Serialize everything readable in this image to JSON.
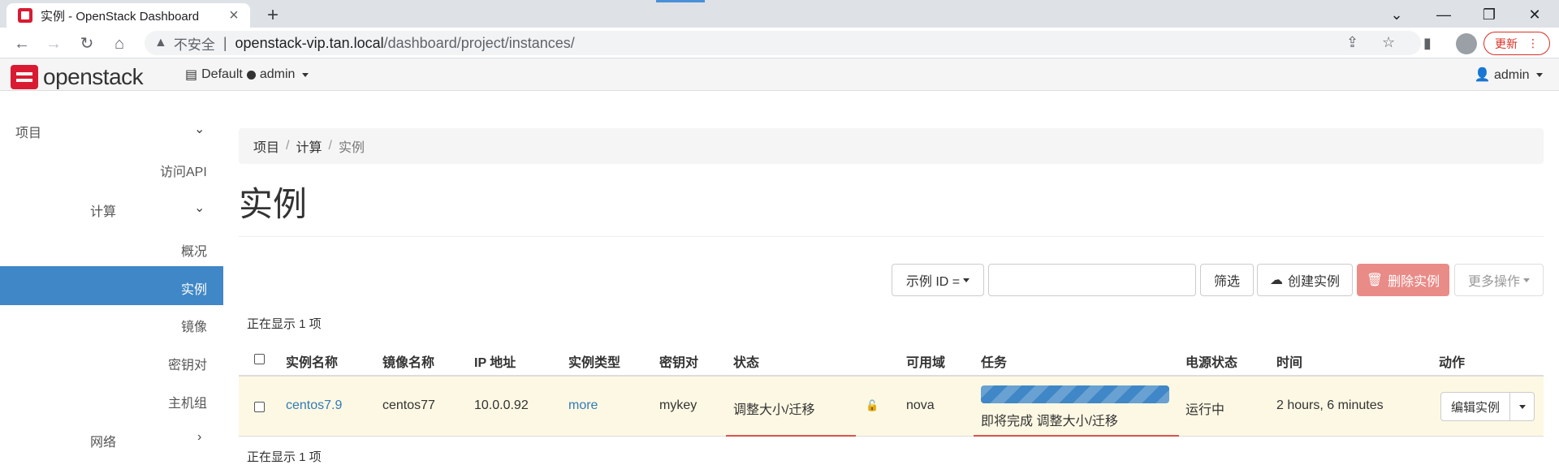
{
  "browser": {
    "tab_title": "实例 - OpenStack Dashboard",
    "new_tab": "+",
    "address_insecure": "不安全",
    "address_host": "openstack-vip.tan.local",
    "address_path": "/dashboard/project/instances/",
    "update_label": "更新"
  },
  "header": {
    "logo_text": "openstack",
    "domain": "Default",
    "project": "admin",
    "user": "admin"
  },
  "sidebar": {
    "project": "项目",
    "api_access": "访问API",
    "compute": "计算",
    "overview": "概况",
    "instances": "实例",
    "images": "镜像",
    "keypairs": "密钥对",
    "server_groups": "主机组",
    "network": "网络"
  },
  "breadcrumb": {
    "root": "项目",
    "compute": "计算",
    "current": "实例"
  },
  "page_title": "实例",
  "toolbar": {
    "filter_field": "示例 ID =",
    "filter_value": "",
    "filter_button": "筛选",
    "create_button": "创建实例",
    "delete_button": "删除实例",
    "more_actions": "更多操作"
  },
  "summary": {
    "top": "正在显示 1 项",
    "bottom": "正在显示 1 项"
  },
  "table": {
    "columns": [
      "实例名称",
      "镜像名称",
      "IP 地址",
      "实例类型",
      "密钥对",
      "状态",
      "可用域",
      "任务",
      "电源状态",
      "时间",
      "动作"
    ],
    "rows": [
      {
        "name": "centos7.9",
        "image": "centos77",
        "ip": "10.0.0.92",
        "flavor": "more",
        "keypair": "mykey",
        "status": "调整大小/迁移",
        "az": "nova",
        "task": "即将完成 调整大小/迁移",
        "task_progress": 1.0,
        "power": "运行中",
        "time": "2 hours, 6 minutes",
        "action": "编辑实例"
      }
    ]
  },
  "colors": {
    "brand_red": "#da1a32",
    "active_nav": "#3f87c6",
    "danger_button": "#e98b87",
    "row_highlight": "#fcf8e3",
    "link": "#337ab7"
  }
}
